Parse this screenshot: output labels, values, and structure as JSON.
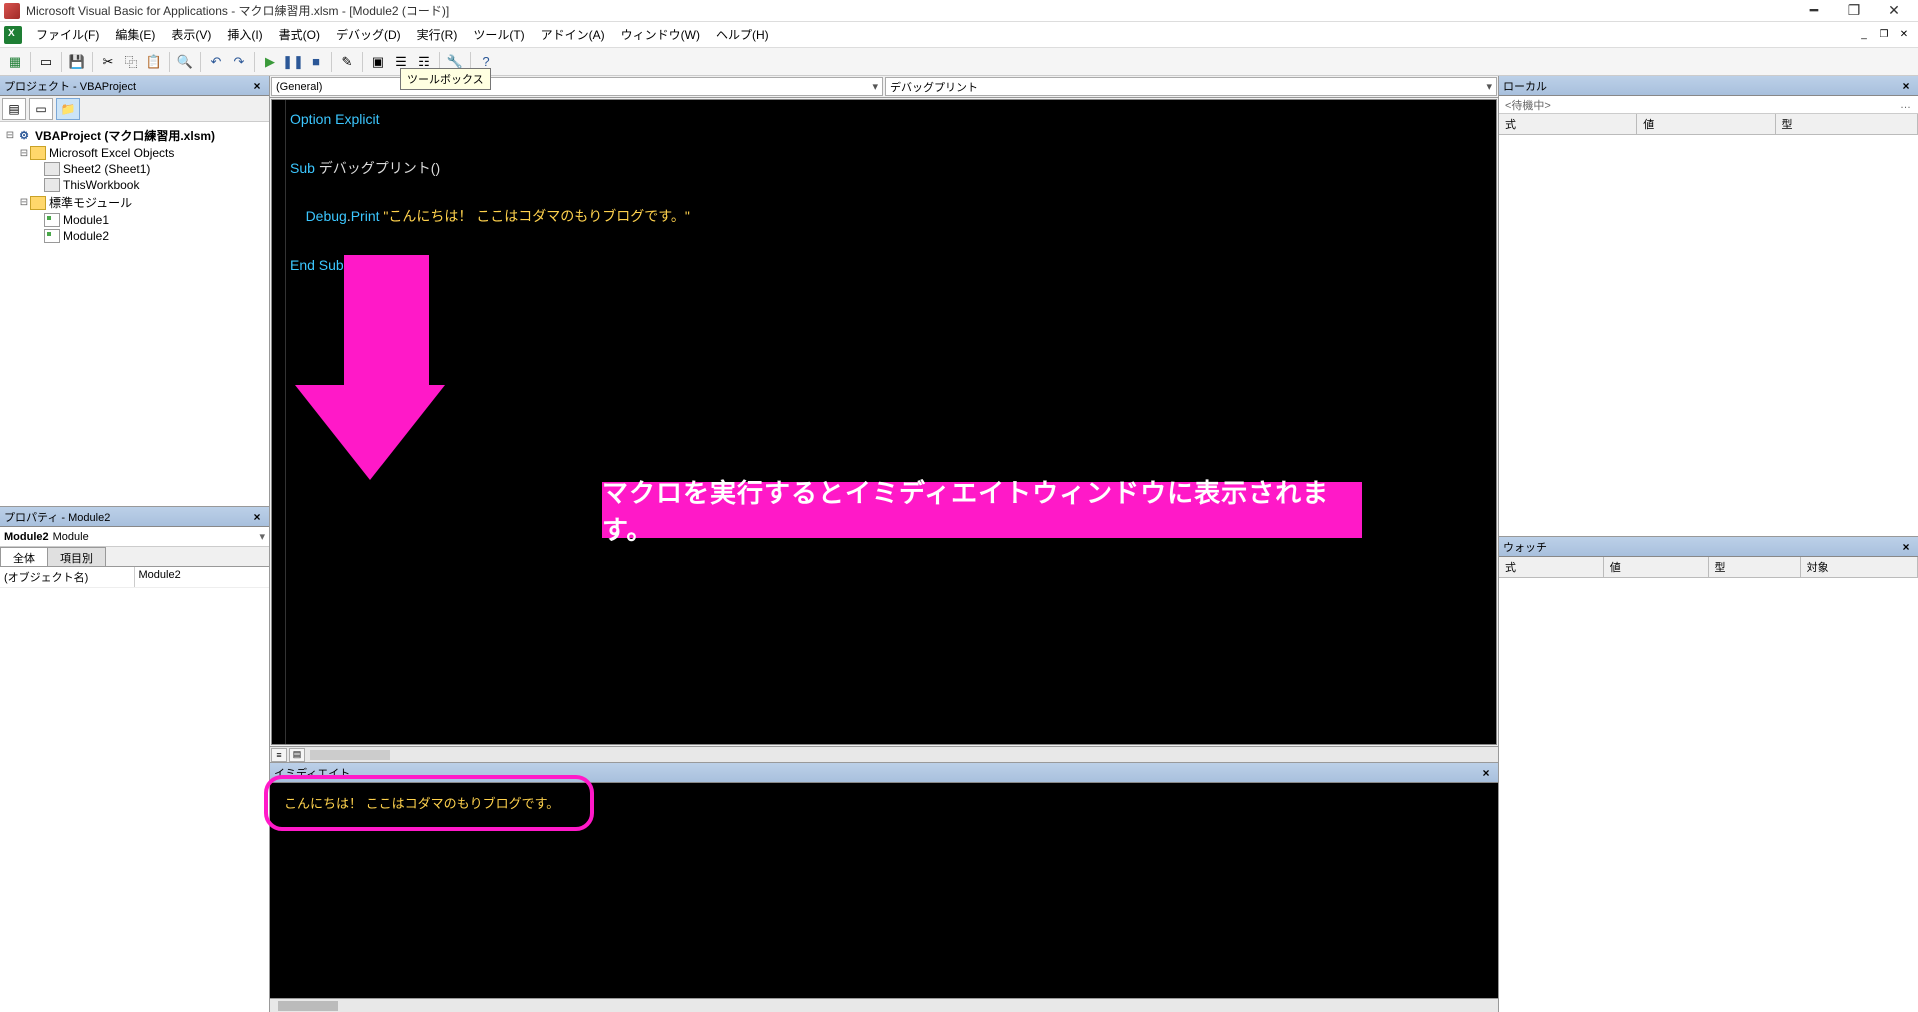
{
  "titlebar": {
    "app_title": "Microsoft Visual Basic for Applications - マクロ練習用.xlsm - [Module2 (コード)]"
  },
  "menu": {
    "file": "ファイル(F)",
    "edit": "編集(E)",
    "view": "表示(V)",
    "insert": "挿入(I)",
    "format": "書式(O)",
    "debug": "デバッグ(D)",
    "run": "実行(R)",
    "tools": "ツール(T)",
    "addins": "アドイン(A)",
    "window": "ウィンドウ(W)",
    "help": "ヘルプ(H)"
  },
  "tooltip": "ツールボックス",
  "project_panel": {
    "title": "プロジェクト - VBAProject",
    "root": "VBAProject (マクロ練習用.xlsm)",
    "excel_objects": "Microsoft Excel Objects",
    "sheet2": "Sheet2 (Sheet1)",
    "thisworkbook": "ThisWorkbook",
    "std_modules": "標準モジュール",
    "module1": "Module1",
    "module2": "Module2"
  },
  "properties_panel": {
    "title": "プロパティ - Module2",
    "object_name": "Module2",
    "object_type": "Module",
    "tab_all": "全体",
    "tab_cat": "項目別",
    "row_name_label": "(オブジェクト名)",
    "row_name_value": "Module2"
  },
  "code_dropdowns": {
    "left": "(General)",
    "right": "デバッグプリント"
  },
  "code": {
    "line1_kw": "Option Explicit",
    "line3_sub": "Sub",
    "line3_name": " デバッグプリント()",
    "line5_indent": "    ",
    "line5_debug": "Debug",
    "line5_dot": ".",
    "line5_print": "Print ",
    "line5_str": "\"こんにちは！ ここはコダマのもりブログです。\"",
    "line7_end": "End Sub"
  },
  "annotation_banner": "マクロを実行するとイミディエイトウィンドウに表示されます。",
  "immediate_panel": {
    "title": "イミディエイト",
    "output": "こんにちは！ ここはコダマのもりブログです。"
  },
  "locals_panel": {
    "title": "ローカル",
    "status": "<待機中>",
    "col_expr": "式",
    "col_val": "値",
    "col_type": "型"
  },
  "watch_panel": {
    "title": "ウォッチ",
    "col_expr": "式",
    "col_val": "値",
    "col_type": "型",
    "col_target": "対象"
  }
}
